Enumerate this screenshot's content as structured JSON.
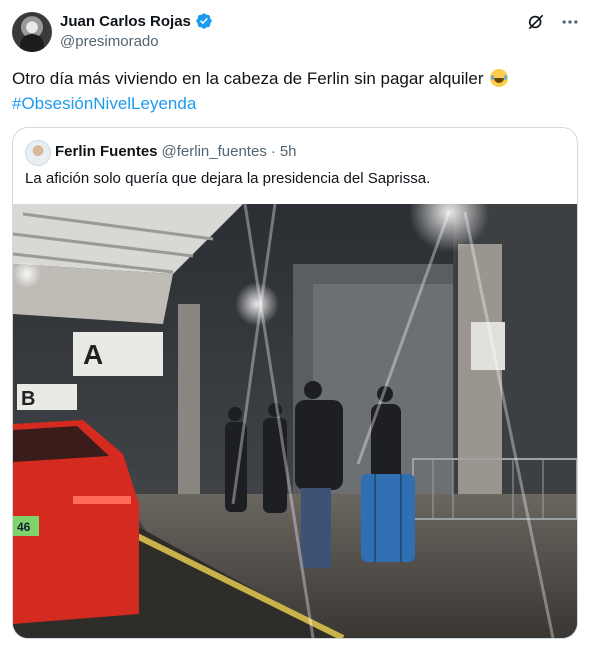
{
  "author": {
    "display_name": "Juan Carlos Rojas",
    "handle": "@presimorado"
  },
  "tweet": {
    "text": "Otro día más viviendo en la cabeza de Ferlin sin pagar alquiler",
    "hashtag": "#ObsesiónNivelLeyenda"
  },
  "icons": [
    "grok-icon",
    "more-icon",
    "verified-icon",
    "laughing-emoji"
  ],
  "quote": {
    "display_name": "Ferlin Fuentes",
    "handle": "@ferlin_fuentes",
    "separator": "·",
    "time": "5h",
    "text": "La afición solo quería que dejara la presidencia del Saprissa.",
    "photo": {
      "signs": [
        "A",
        "B"
      ],
      "plate": "46"
    }
  },
  "colors": {
    "accent": "#1d9bf0",
    "muted": "#536471",
    "border": "#cfd9de",
    "car": "#d42a20",
    "luggage": "#2f6fb2"
  }
}
